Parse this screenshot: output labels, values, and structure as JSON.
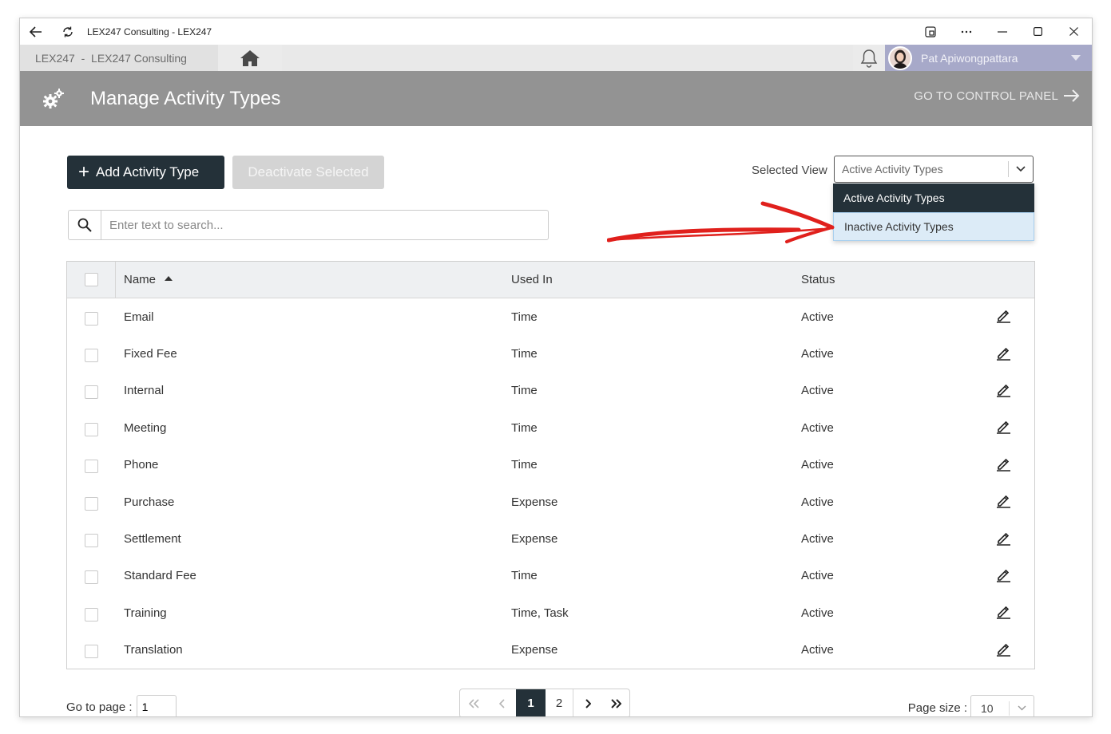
{
  "window": {
    "title": "LEX247 Consulting - LEX247"
  },
  "appbar": {
    "breadcrumb": "LEX247  -  LEX247 Consulting",
    "user_name": "Pat Apiwongpattara"
  },
  "header": {
    "title": "Manage Activity Types",
    "control_panel_link": "GO TO CONTROL PANEL"
  },
  "toolbar": {
    "add_label": "Add Activity Type",
    "deactivate_label": "Deactivate Selected"
  },
  "view": {
    "label": "Selected View",
    "selected": "Active Activity Types",
    "options": [
      "Active Activity Types",
      "Inactive Activity Types"
    ]
  },
  "search": {
    "placeholder": "Enter text to search..."
  },
  "table": {
    "columns": {
      "name": "Name",
      "used_in": "Used In",
      "status": "Status"
    },
    "sort": {
      "column": "Name",
      "direction": "ascending"
    },
    "rows": [
      {
        "name": "Email",
        "used_in": "Time",
        "status": "Active"
      },
      {
        "name": "Fixed Fee",
        "used_in": "Time",
        "status": "Active"
      },
      {
        "name": "Internal",
        "used_in": "Time",
        "status": "Active"
      },
      {
        "name": "Meeting",
        "used_in": "Time",
        "status": "Active"
      },
      {
        "name": "Phone",
        "used_in": "Time",
        "status": "Active"
      },
      {
        "name": "Purchase",
        "used_in": "Expense",
        "status": "Active"
      },
      {
        "name": "Settlement",
        "used_in": "Expense",
        "status": "Active"
      },
      {
        "name": "Standard Fee",
        "used_in": "Time",
        "status": "Active"
      },
      {
        "name": "Training",
        "used_in": "Time, Task",
        "status": "Active"
      },
      {
        "name": "Translation",
        "used_in": "Expense",
        "status": "Active"
      }
    ]
  },
  "pagination": {
    "goto_label": "Go to page :",
    "goto_value": "1",
    "pages": [
      "1",
      "2"
    ],
    "current_page": "1",
    "page_size_label": "Page size :",
    "page_size": "10"
  },
  "colors": {
    "header_bg": "#939393",
    "primary_dark": "#243139",
    "user_bg": "#a7a9c9",
    "annotation_red": "#e0201c"
  }
}
